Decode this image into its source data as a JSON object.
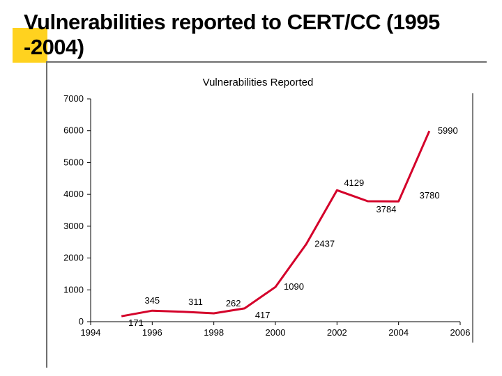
{
  "slide": {
    "title": "Vulnerabilities reported to CERT/CC (1995 -2004)"
  },
  "chart_data": {
    "type": "line",
    "title": "Vulnerabilities Reported",
    "xlabel": "",
    "ylabel": "",
    "xlim": [
      1994,
      2006
    ],
    "ylim": [
      0,
      7000
    ],
    "x_ticks": [
      1994,
      1996,
      1998,
      2000,
      2002,
      2004,
      2006
    ],
    "y_ticks": [
      0,
      1000,
      2000,
      3000,
      4000,
      5000,
      6000,
      7000
    ],
    "series": [
      {
        "name": "Vulnerabilities Reported",
        "color": "#d4002a",
        "x": [
          1995,
          1996,
          1997,
          1998,
          1999,
          2000,
          2001,
          2002,
          2003,
          2004
        ],
        "values": [
          171,
          345,
          311,
          262,
          417,
          1090,
          2437,
          4129,
          3784,
          3780
        ]
      }
    ],
    "final_label": {
      "x": 2005,
      "value": 5990
    }
  }
}
